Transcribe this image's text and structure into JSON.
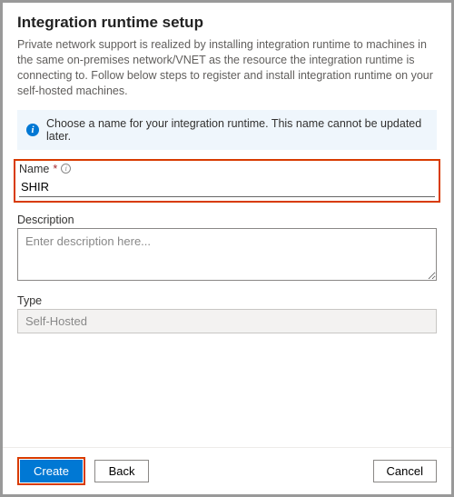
{
  "title": "Integration runtime setup",
  "intro": "Private network support is realized by installing integration runtime to machines in the same on-premises network/VNET as the resource the integration runtime is connecting to. Follow below steps to register and install integration runtime on your self-hosted machines.",
  "info_banner": "Choose a name for your integration runtime. This name cannot be updated later.",
  "fields": {
    "name": {
      "label": "Name",
      "required_marker": "*",
      "value": "SHIR"
    },
    "description": {
      "label": "Description",
      "placeholder": "Enter description here...",
      "value": ""
    },
    "type": {
      "label": "Type",
      "value": "Self-Hosted"
    }
  },
  "buttons": {
    "create": "Create",
    "back": "Back",
    "cancel": "Cancel"
  },
  "colors": {
    "primary": "#0078d4",
    "highlight_border": "#d83b01",
    "info_bg": "#eff6fc"
  }
}
